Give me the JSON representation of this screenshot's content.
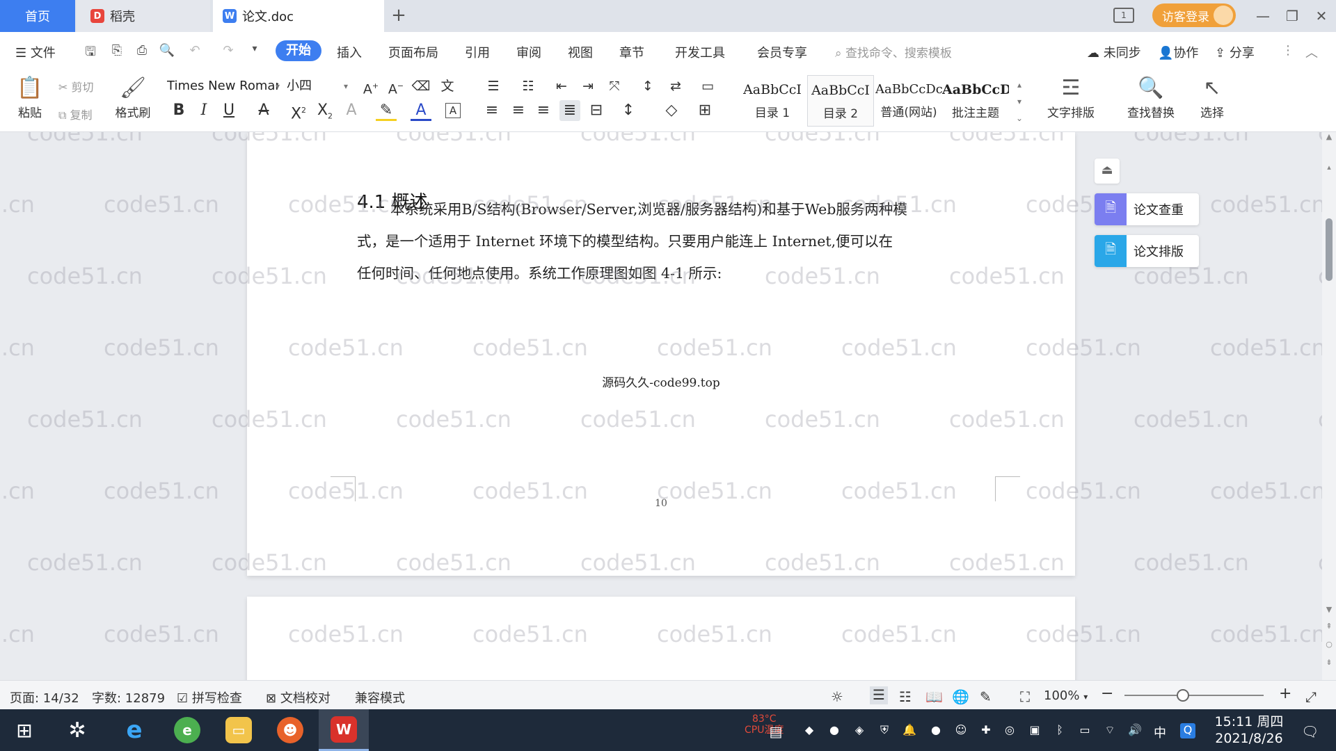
{
  "tabs": {
    "home": "首页",
    "daoke": "稻壳",
    "doc": "论文.doc",
    "add": "+"
  },
  "window": {
    "login": "访客登录",
    "minimize": "—",
    "restore": "❐",
    "close": "✕"
  },
  "menu": {
    "file": "文件",
    "items": [
      "开始",
      "插入",
      "页面布局",
      "引用",
      "审阅",
      "视图",
      "章节",
      "开发工具",
      "会员专享"
    ],
    "search_placeholder": "查找命令、搜索模板",
    "unsynced": "未同步",
    "collaborate": "协作",
    "share": "分享"
  },
  "ribbon": {
    "paste": "粘贴",
    "cut": "剪切",
    "copy": "复制",
    "format_painter": "格式刷",
    "font_name": "Times New Roman",
    "font_size": "小四",
    "styles": [
      {
        "preview": "AaBbCcI",
        "name": "目录 1"
      },
      {
        "preview": "AaBbCcI",
        "name": "目录 2"
      },
      {
        "preview": "AaBbCcDc",
        "name": "普通(网站)"
      },
      {
        "preview": "AaBbCcD",
        "name": "批注主题"
      }
    ],
    "text_layout": "文字排版",
    "find_replace": "查找替换",
    "select": "选择"
  },
  "document": {
    "heading": "4.1 概述",
    "paragraph_lines": [
      "本系统采用B/S结构(Browser/Server,浏览器/服务器结构)和基于Web服务两种模",
      "式，是一个适用于 Internet 环境下的模型结构。只要用户能连上 Internet,便可以在",
      "任何时间、任何地点使用。系统工作原理图如图 4-1 所示:"
    ],
    "caption": "源码久久-code99.top",
    "page_number": "10",
    "watermark": "code51.cn"
  },
  "side_panel": {
    "check": "论文查重",
    "layout": "论文排版"
  },
  "status": {
    "page": "页面: 14/32",
    "words": "字数: 12879",
    "spell": "拼写检查",
    "proof": "文档校对",
    "compat": "兼容模式",
    "zoom": "100%",
    "zoom_level": 0.42
  },
  "taskbar": {
    "cpu_temp": "83°C",
    "cpu_label": "CPU温度",
    "ime": "中",
    "time": "15:11 周四",
    "date": "2021/8/26"
  },
  "colors": {
    "accent": "#3d7ef0",
    "login": "#f0a03a",
    "taskbar": "#1e2a3a"
  }
}
